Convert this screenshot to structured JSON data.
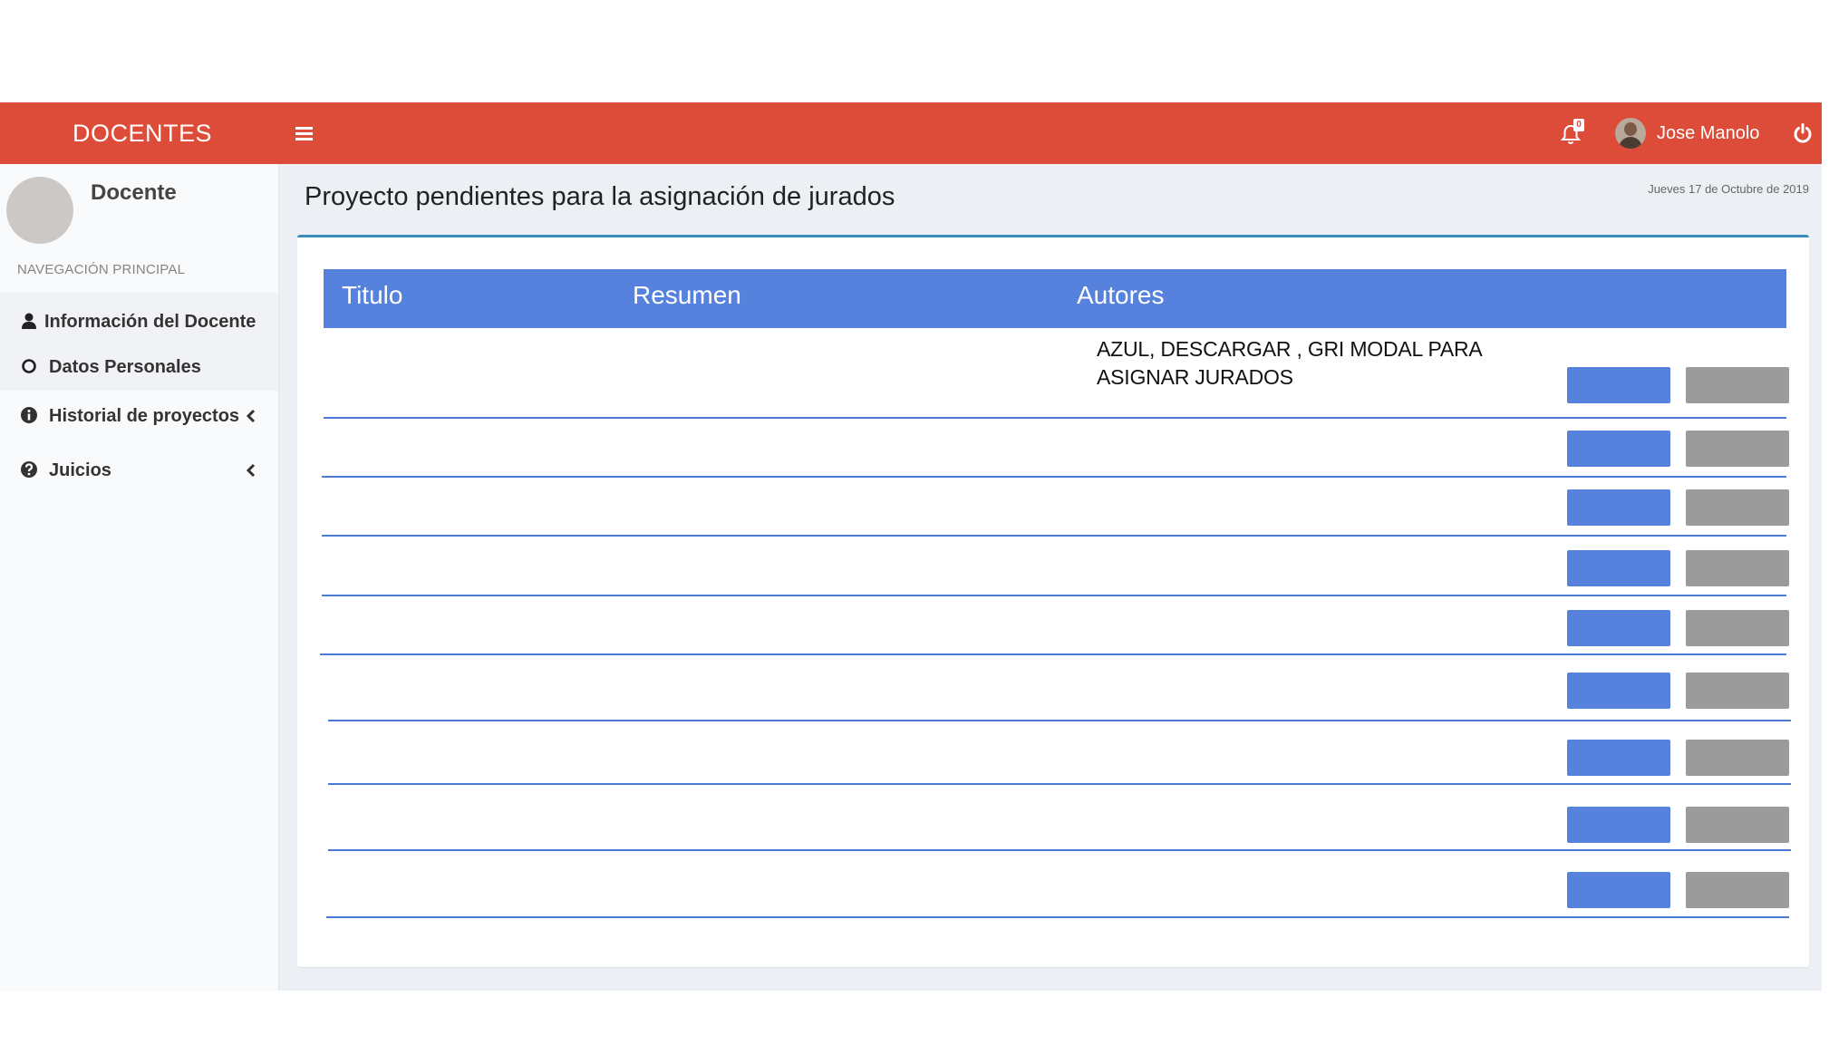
{
  "header": {
    "brand": "DOCENTES",
    "notifications_count": "0",
    "user_name": "Jose Manolo"
  },
  "sidebar": {
    "user_label": "Docente",
    "nav_header": "NAVEGACIÓN PRINCIPAL",
    "items": [
      {
        "label": "Información del Docente",
        "icon": "user-icon"
      },
      {
        "label": "Datos Personales",
        "icon": "circle-outline-icon"
      },
      {
        "label": "Historial de proyectos",
        "icon": "info-circle-icon"
      },
      {
        "label": "Juicios",
        "icon": "question-circle-icon"
      }
    ]
  },
  "main": {
    "title": "Proyecto pendientes para la asignación de jurados",
    "date": "Jueves 17 de Octubre de 2019",
    "table": {
      "headers": [
        "Titulo",
        "Resumen",
        "Autores"
      ],
      "note_line1": "AZUL, DESCARGAR , GRI MODAL PARA",
      "note_line2": "ASIGNAR JURADOS",
      "row_count": 9
    }
  },
  "colors": {
    "topbar": "#dd4b39",
    "table_header": "#5682dd",
    "download_button": "#5682dd",
    "modal_button": "#9b9b9b",
    "row_divider": "#4a7ad6"
  }
}
